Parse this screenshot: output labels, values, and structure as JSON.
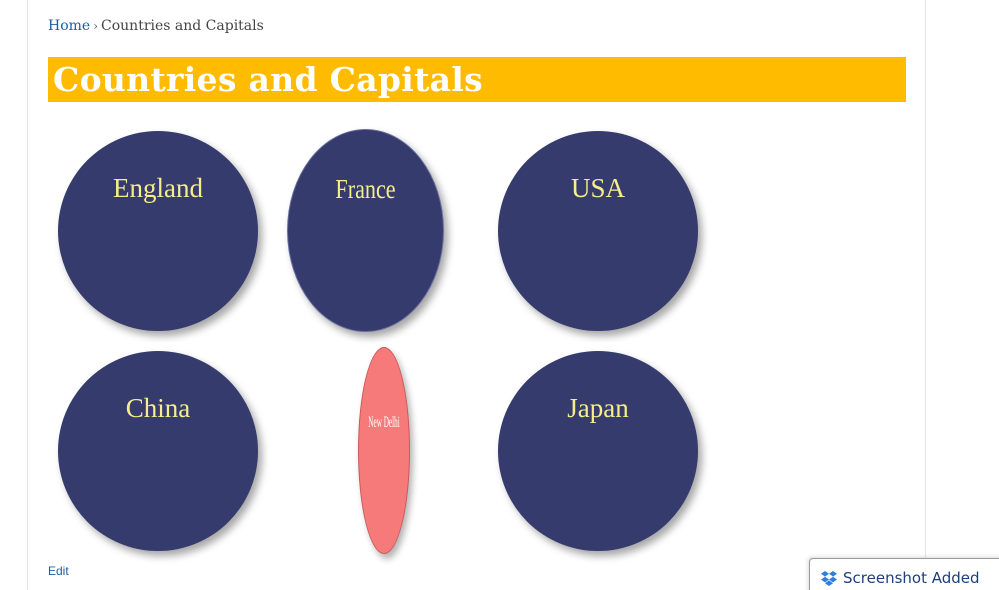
{
  "breadcrumb": {
    "home": "Home",
    "separator": "›",
    "current": "Countries and Capitals"
  },
  "page": {
    "title": "Countries and Capitals",
    "edit_label": "Edit"
  },
  "cards": [
    {
      "label": "England",
      "flipped": false
    },
    {
      "label": "France",
      "flipped": false
    },
    {
      "label": "USA",
      "flipped": false
    },
    {
      "label": "China",
      "flipped": false
    },
    {
      "label": "New Delhi",
      "flipped": true
    },
    {
      "label": "Japan",
      "flipped": false
    }
  ],
  "notification": {
    "icon": "dropbox-icon",
    "text": "Screenshot Added"
  },
  "colors": {
    "title_bar": "#ffbb00",
    "card_front": "#353b6d",
    "card_back": "#f77a7a",
    "card_label": "#f5ee8a",
    "link": "#1a5ea8"
  }
}
